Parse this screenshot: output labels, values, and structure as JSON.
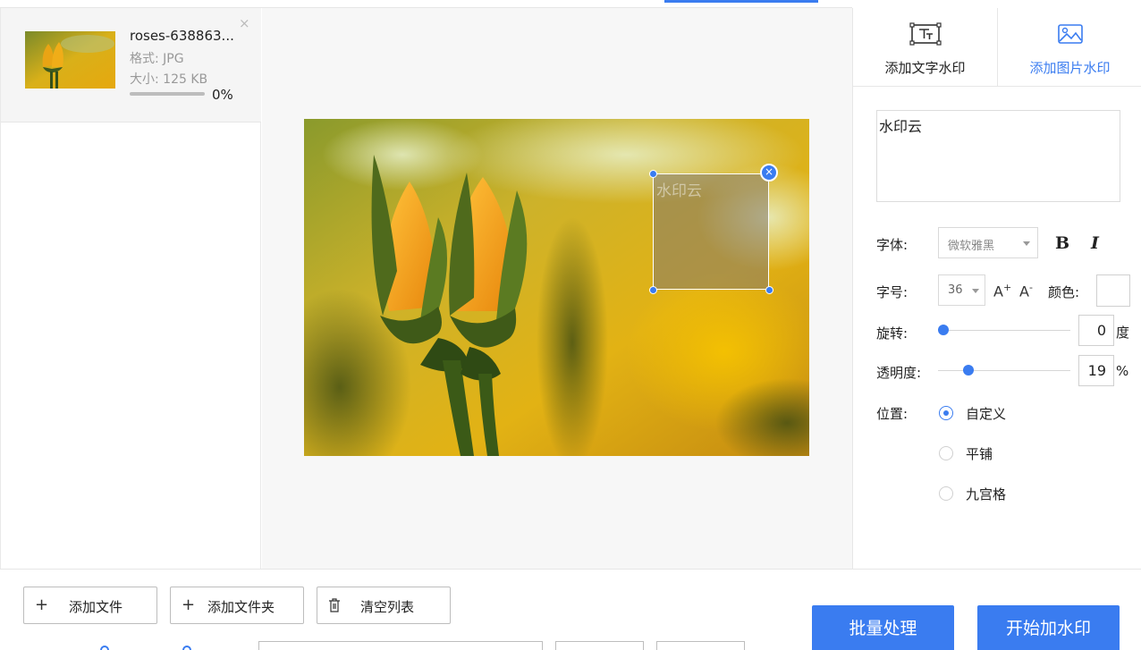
{
  "file_list": {
    "items": [
      {
        "name": "roses-638863...",
        "format": "格式: JPG",
        "size": "大小: 125 KB",
        "progress_value": 0,
        "progress_text": "0%",
        "close_symbol": "×"
      }
    ]
  },
  "preview": {
    "watermark_text": "水印云",
    "close_symbol": "×"
  },
  "settings": {
    "tabs": [
      {
        "label": "添加文字水印",
        "icon": "text-watermark-icon",
        "active": false
      },
      {
        "label": "添加图片水印",
        "icon": "image-watermark-icon",
        "active": true
      }
    ],
    "watermark_text": "水印云",
    "font_label": "字体:",
    "font_value": "微软雅黑",
    "bold_label": "B",
    "italic_label": "I",
    "size_label": "字号:",
    "size_value": "36",
    "increase_label": "A",
    "increase_sup": "+",
    "decrease_label": "A",
    "decrease_sup": "-",
    "color_label": "颜色:",
    "color_value": "#ffffff",
    "rotation_label": "旋转:",
    "rotation_value": "0",
    "rotation_unit": "度",
    "rotation_fraction": 0.0,
    "opacity_label": "透明度:",
    "opacity_value": "19",
    "opacity_unit": "%",
    "opacity_fraction": 0.19,
    "position_label": "位置:",
    "position_options": [
      {
        "label": "自定义",
        "checked": true
      },
      {
        "label": "平铺",
        "checked": false
      },
      {
        "label": "九宫格",
        "checked": false
      }
    ]
  },
  "bottom": {
    "add_file_label": "添加文件",
    "add_folder_label": "添加文件夹",
    "clear_list_label": "清空列表",
    "plus_symbol": "+",
    "batch_label": "批量处理",
    "start_label": "开始加水印"
  },
  "colors": {
    "accent": "#3a7cf0",
    "border": "#e6e6e6"
  }
}
